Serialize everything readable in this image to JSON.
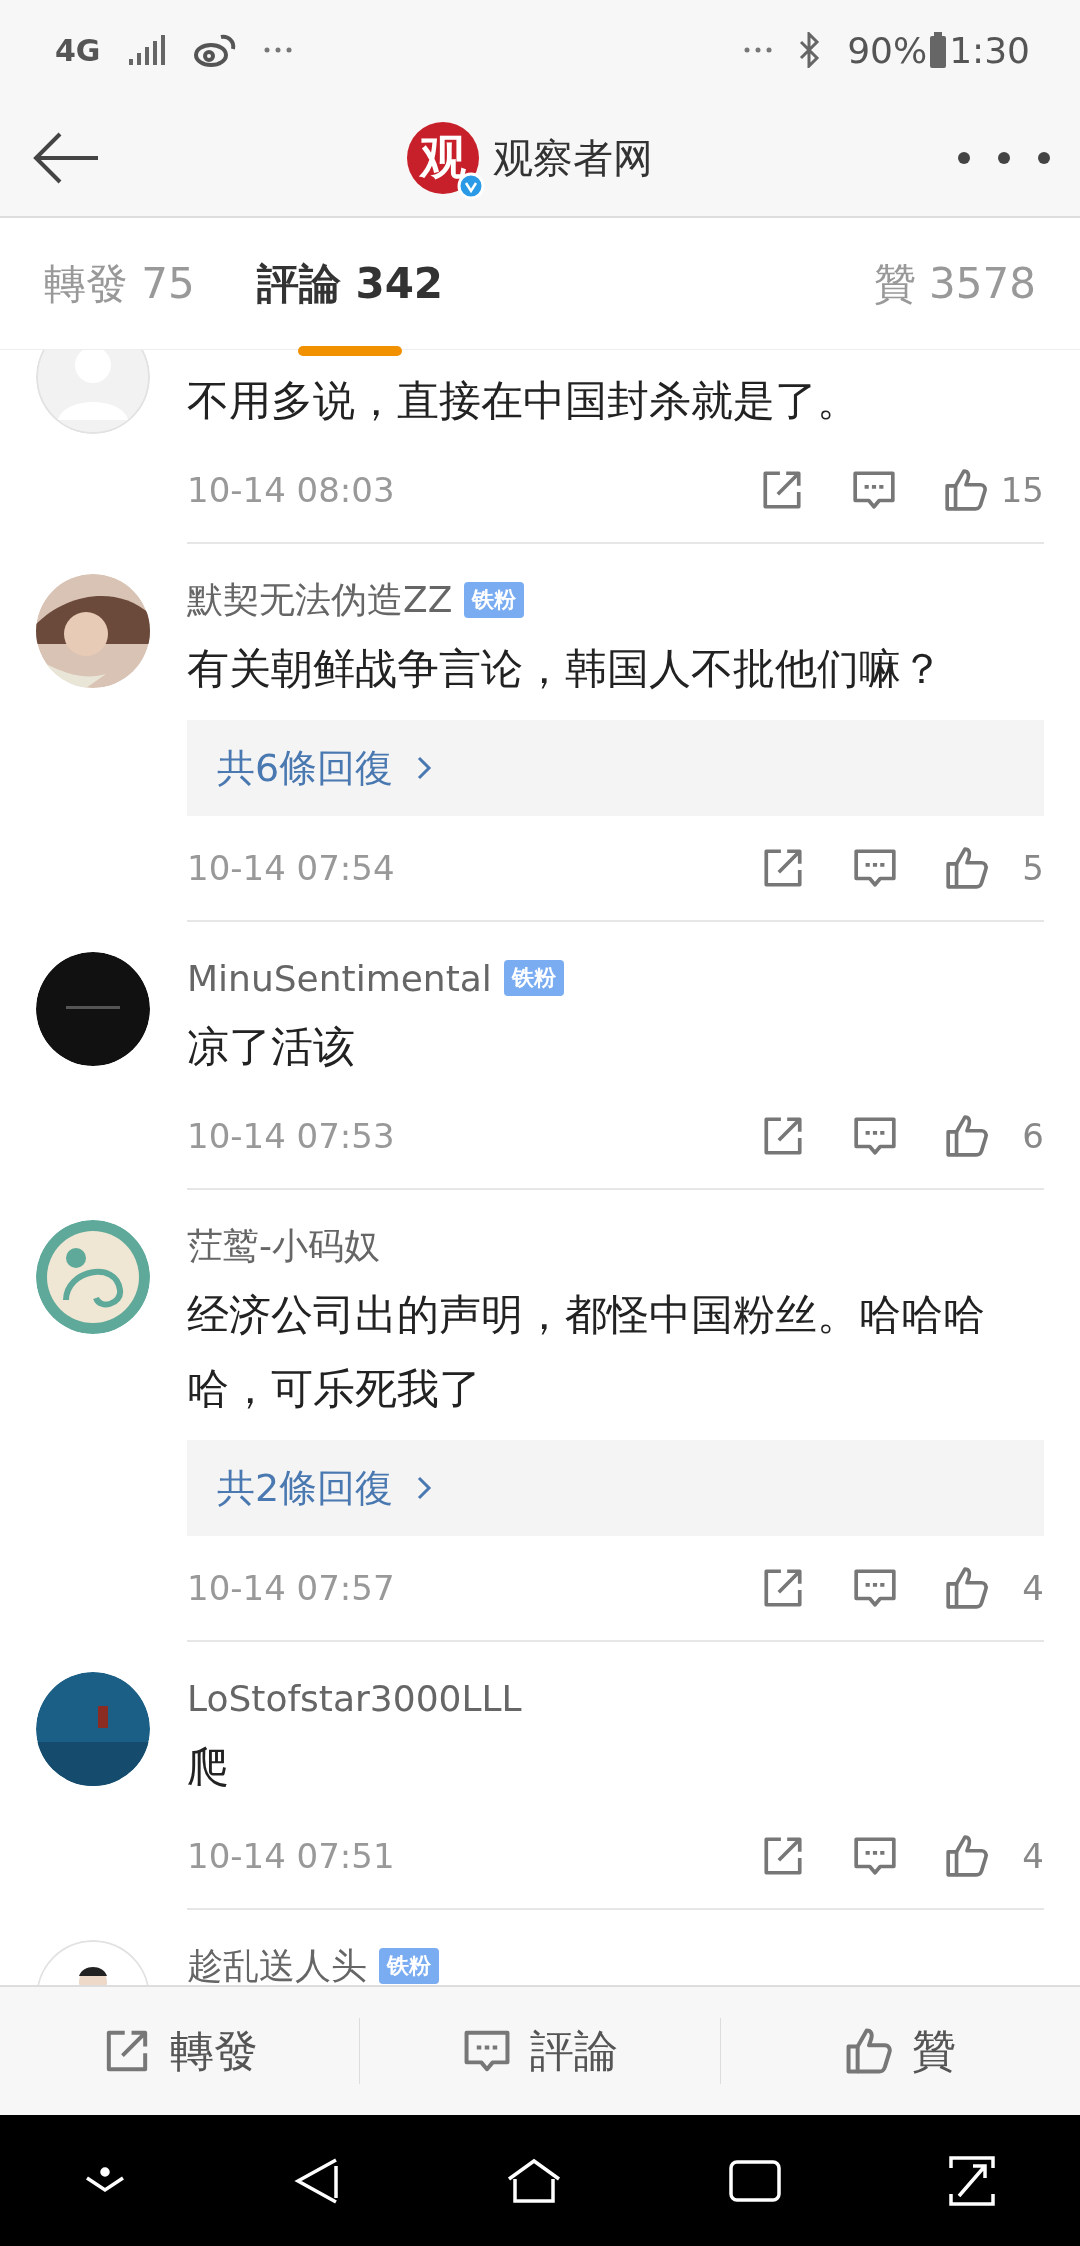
{
  "status_bar": {
    "network": "4G",
    "battery": "90%",
    "time": "1:30"
  },
  "header": {
    "logo_text": "观",
    "title": "观察者网",
    "verified": true
  },
  "tabs": [
    {
      "label": "轉發 75",
      "selected": false
    },
    {
      "label": "評論 342",
      "selected": true
    },
    {
      "label": "贊 3578",
      "selected": false
    }
  ],
  "comments": [
    {
      "text": "不用多说，直接在中国封杀就是了。",
      "time": "10-14 08:03",
      "likes": "15"
    },
    {
      "name": "默契无法伪造ZZ",
      "badge": "铁粉",
      "text": "有关朝鲜战争言论，韩国人不批他们嘛？",
      "replies": "共6條回復",
      "time": "10-14 07:54",
      "likes": "5"
    },
    {
      "name": "MinuSentimental",
      "badge": "铁粉",
      "text": "凉了活该",
      "time": "10-14 07:53",
      "likes": "6"
    },
    {
      "name": "茳鹫-小码奴",
      "text": "经济公司出的声明，都怪中国粉丝。哈哈哈哈，可乐死我了",
      "replies": "共2條回復",
      "time": "10-14 07:57",
      "likes": "4"
    },
    {
      "name": "LoStofstar3000LLL",
      "text": "爬",
      "time": "10-14 07:51",
      "likes": "4"
    },
    {
      "name": "趁乱送人头",
      "badge": "铁粉"
    }
  ],
  "bottom_bar": [
    {
      "kind": "share",
      "label": "轉發"
    },
    {
      "kind": "comment",
      "label": "評論"
    },
    {
      "kind": "like",
      "label": "贊"
    }
  ]
}
